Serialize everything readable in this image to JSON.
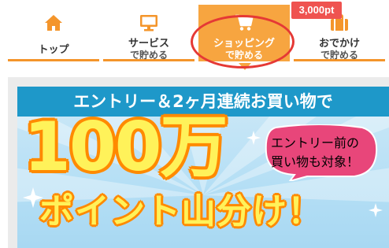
{
  "nav": {
    "tabs": [
      {
        "icon": "home-icon",
        "line1": "トップ",
        "line2": ""
      },
      {
        "icon": "monitor-icon",
        "line1": "サービス",
        "line2": "で貯める"
      },
      {
        "icon": "cart-icon",
        "line1": "ショッピング",
        "line2": "で貯める"
      },
      {
        "icon": "bag-icon",
        "line1": "おでかけ",
        "line2": "で貯める"
      }
    ],
    "active_tab": "ショッピング",
    "badge": "3,000pt"
  },
  "banner": {
    "headline": "エントリー＆2ヶ月連続お買い物で",
    "amount": "100万",
    "subline": "ポイント山分け！",
    "bubble_line1": "エントリー前の",
    "bubble_line2": "買い物も対象！"
  },
  "colors": {
    "accent": "#f7a540",
    "tab_underline": "#f4952b",
    "badge": "#ef5350",
    "highlight_ring": "#e53935",
    "banner_head": "#1e98c9",
    "bubble": "#e8467a",
    "headline_text_fill": "#fff25a",
    "headline_text_stroke": "#ff8a00"
  }
}
